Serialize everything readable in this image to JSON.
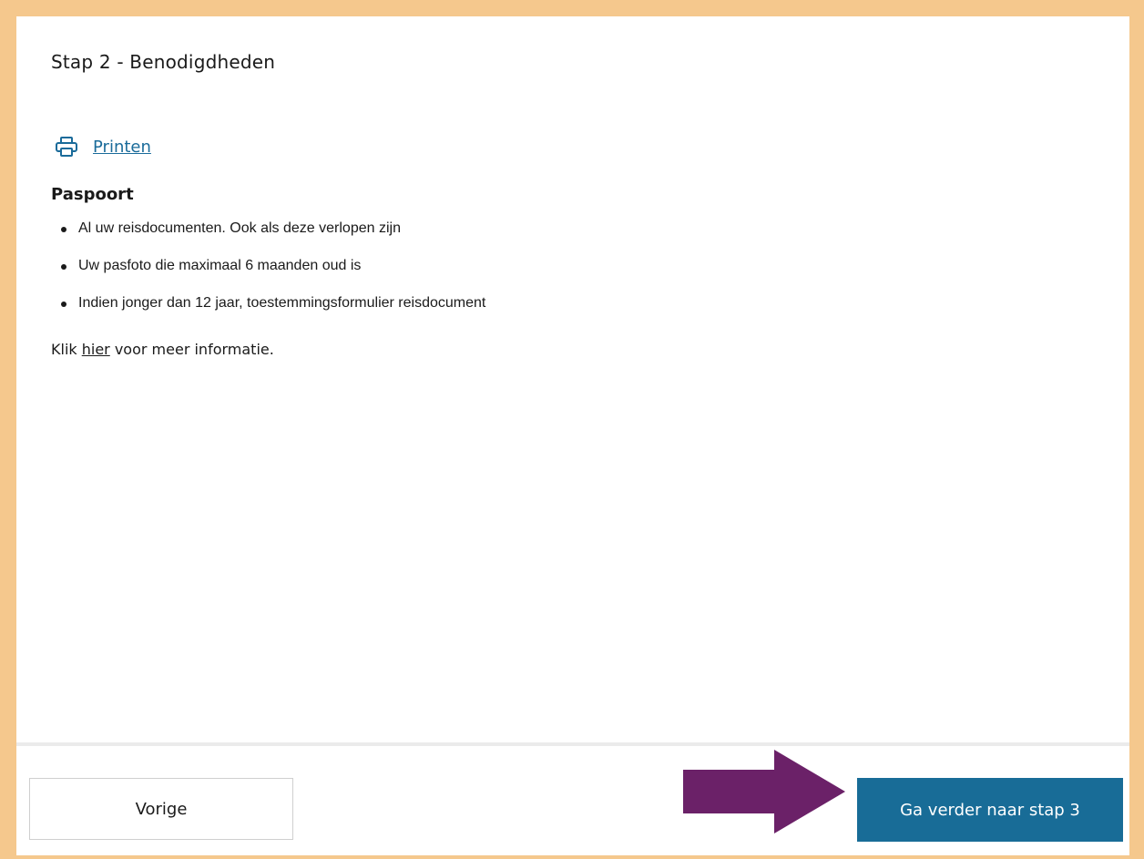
{
  "step": {
    "title": "Stap 2 - Benodigdheden"
  },
  "print": {
    "icon": "printer-icon",
    "label": "Printen"
  },
  "section": {
    "title": "Paspoort",
    "items": [
      "Al uw reisdocumenten. Ook als deze verlopen zijn",
      "Uw pasfoto die maximaal 6 maanden oud is",
      "Indien jonger dan 12 jaar, toestemmingsformulier reisdocument"
    ]
  },
  "more_info": {
    "prefix": "Klik ",
    "link": "hier",
    "suffix": " voor meer informatie."
  },
  "footer": {
    "prev_label": "Vorige",
    "next_label": "Ga verder naar stap 3"
  },
  "colors": {
    "frame": "#f5c88d",
    "link": "#1a6b9a",
    "primary_button": "#186c97",
    "arrow": "#6b2168"
  }
}
